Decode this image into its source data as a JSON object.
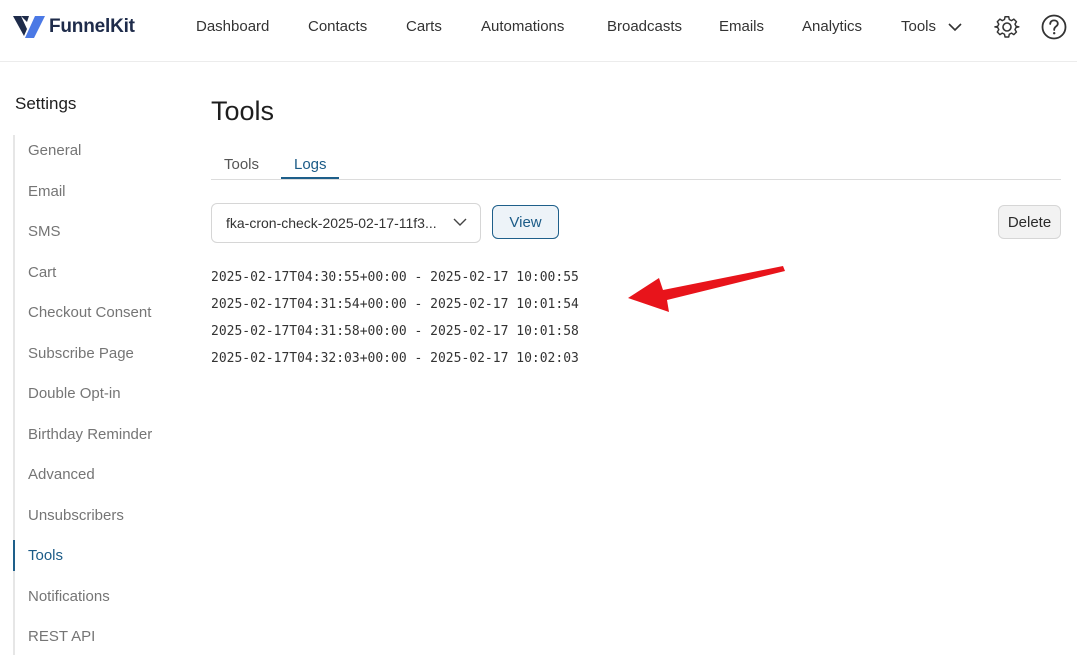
{
  "brand": {
    "name": "FunnelKit"
  },
  "nav": {
    "items": [
      "Dashboard",
      "Contacts",
      "Carts",
      "Automations",
      "Broadcasts",
      "Emails",
      "Analytics"
    ],
    "tools_label": "Tools"
  },
  "sidebar": {
    "title": "Settings",
    "items": [
      {
        "label": "General"
      },
      {
        "label": "Email"
      },
      {
        "label": "SMS"
      },
      {
        "label": "Cart"
      },
      {
        "label": "Checkout Consent"
      },
      {
        "label": "Subscribe Page"
      },
      {
        "label": "Double Opt-in"
      },
      {
        "label": "Birthday Reminder"
      },
      {
        "label": "Advanced"
      },
      {
        "label": "Unsubscribers"
      },
      {
        "label": "Tools",
        "active": true
      },
      {
        "label": "Notifications"
      },
      {
        "label": "REST API"
      }
    ]
  },
  "main": {
    "title": "Tools",
    "tabs": [
      {
        "label": "Tools",
        "active": false
      },
      {
        "label": "Logs",
        "active": true
      }
    ],
    "log_select": {
      "value": "fka-cron-check-2025-02-17-11f3..."
    },
    "view_label": "View",
    "delete_label": "Delete",
    "log_lines": [
      "2025-02-17T04:30:55+00:00 - 2025-02-17 10:00:55",
      "2025-02-17T04:31:54+00:00 - 2025-02-17 10:01:54",
      "2025-02-17T04:31:58+00:00 - 2025-02-17 10:01:58",
      "2025-02-17T04:32:03+00:00 - 2025-02-17 10:02:03"
    ]
  },
  "colors": {
    "accent": "#1e5f8a",
    "annotation_arrow": "#e8141b"
  },
  "icons": [
    "funnelkit-logo-icon",
    "chevron-down-icon",
    "gear-icon",
    "help-icon",
    "red-arrow-annotation"
  ]
}
